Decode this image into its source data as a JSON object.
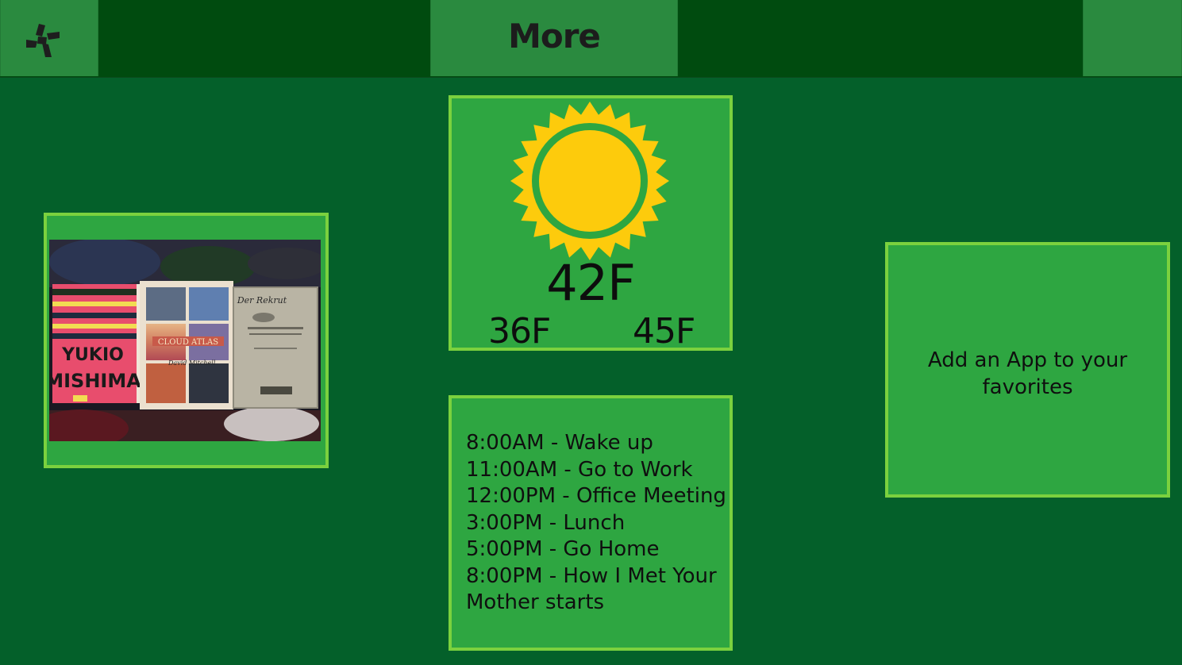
{
  "header": {
    "more_label": "More"
  },
  "weather": {
    "current_temp": "42F",
    "low_temp": "36F",
    "high_temp": "45F",
    "condition_icon": "sun-icon"
  },
  "photo": {
    "caption_texts": [
      "YUKIO MISHIMA",
      "CLOUD ATLAS",
      "David Mitchell",
      "Der Rekrut"
    ]
  },
  "schedule": {
    "items": [
      "8:00AM - Wake up",
      "11:00AM - Go to Work",
      "12:00PM - Office Meeting",
      "3:00PM - Lunch",
      "5:00PM - Go Home",
      "8:00PM - How I Met Your Mother starts"
    ]
  },
  "add_app": {
    "label": "Add an App to your favorites"
  },
  "colors": {
    "background": "#04602a",
    "topbar": "#004b0f",
    "top_button": "#2a8a3f",
    "tile": "#2ea641",
    "tile_border": "#7bd13e",
    "sun": "#fdcb0c"
  }
}
